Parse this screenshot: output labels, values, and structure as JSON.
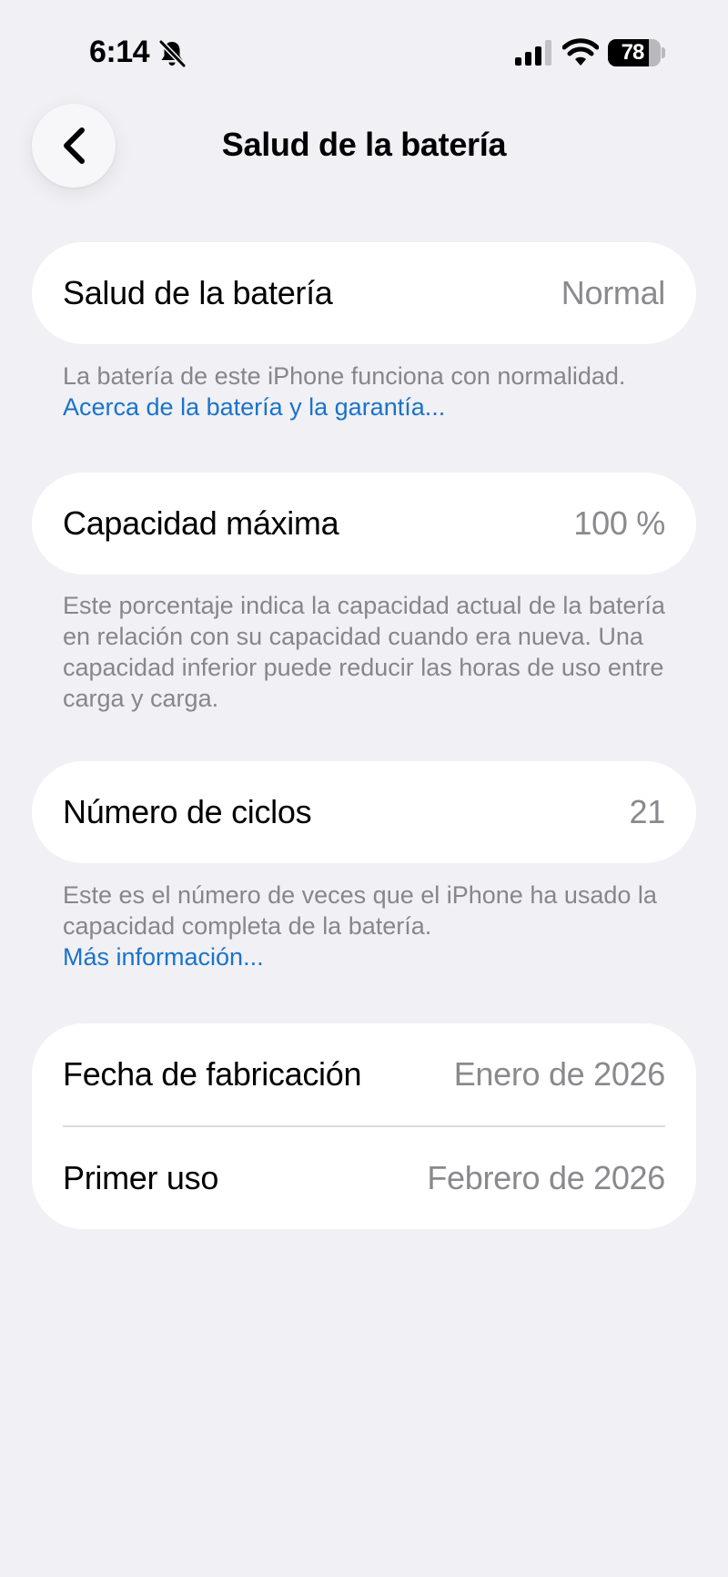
{
  "status_bar": {
    "time": "6:14",
    "battery_percent": 78
  },
  "nav": {
    "title": "Salud de la batería"
  },
  "sections": {
    "health": {
      "label": "Salud de la batería",
      "value": "Normal",
      "footer_text": "La batería de este iPhone funciona con normalidad.",
      "footer_link": "Acerca de la batería y la garantía..."
    },
    "capacity": {
      "label": "Capacidad máxima",
      "value": "100 %",
      "footer_text": "Este porcentaje indica la capacidad actual de la batería en relación con su capacidad cuando era nueva. Una capacidad inferior puede reducir las horas de uso entre carga y carga."
    },
    "cycles": {
      "label": "Número de ciclos",
      "value": "21",
      "footer_text": "Este es el número de veces que el iPhone ha usado la capacidad completa de la batería.",
      "footer_link": "Más información..."
    },
    "dates": {
      "manufacture_label": "Fecha de fabricación",
      "manufacture_value": "Enero de 2026",
      "first_use_label": "Primer uso",
      "first_use_value": "Febrero de 2026"
    }
  },
  "icons": {
    "back": "chevron-left-icon",
    "silent": "bell-slash-icon",
    "signal": "cellular-signal-icon",
    "wifi": "wifi-icon",
    "battery": "battery-icon"
  },
  "colors": {
    "background": "#f0f0f5",
    "card": "#ffffff",
    "secondary_text": "#8a8a8e",
    "link": "#1a73c9"
  }
}
